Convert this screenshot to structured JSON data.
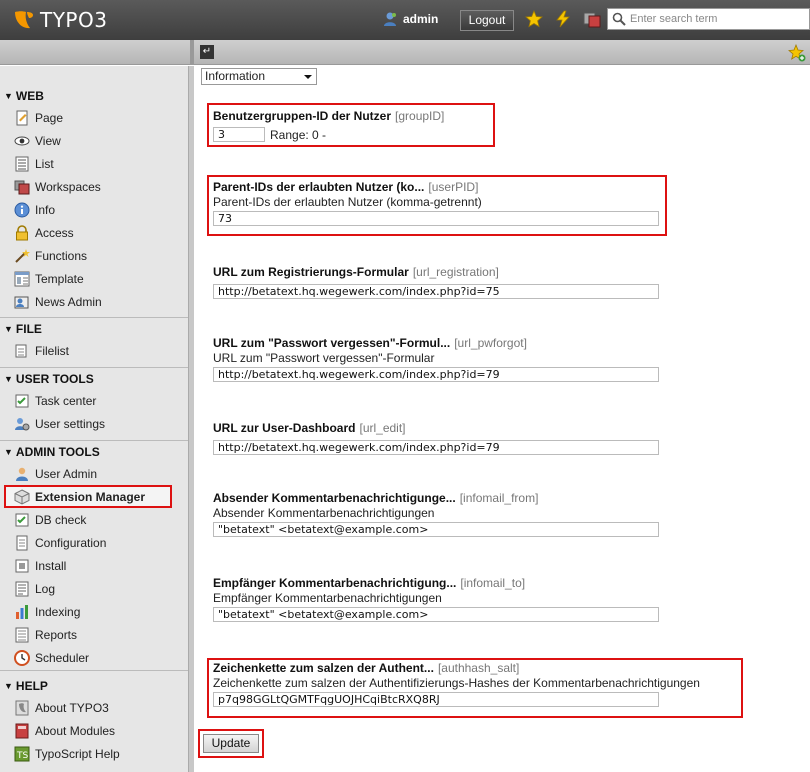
{
  "app": {
    "logo_text": "TYPO3"
  },
  "topbar": {
    "username": "admin",
    "logout_label": "Logout",
    "search_placeholder": "Enter search term"
  },
  "sidebar": {
    "groups": [
      {
        "title": "WEB",
        "items": [
          {
            "label": "Page",
            "icon": "page-icon"
          },
          {
            "label": "View",
            "icon": "eye-icon"
          },
          {
            "label": "List",
            "icon": "list-icon"
          },
          {
            "label": "Workspaces",
            "icon": "workspaces-icon"
          },
          {
            "label": "Info",
            "icon": "info-icon"
          },
          {
            "label": "Access",
            "icon": "lock-icon"
          },
          {
            "label": "Functions",
            "icon": "wand-icon"
          },
          {
            "label": "Template",
            "icon": "template-icon"
          },
          {
            "label": "News Admin",
            "icon": "news-icon"
          }
        ]
      },
      {
        "title": "FILE",
        "items": [
          {
            "label": "Filelist",
            "icon": "folder-icon"
          }
        ]
      },
      {
        "title": "USER TOOLS",
        "items": [
          {
            "label": "Task center",
            "icon": "task-icon"
          },
          {
            "label": "User settings",
            "icon": "user-settings-icon"
          }
        ]
      },
      {
        "title": "ADMIN TOOLS",
        "items": [
          {
            "label": "User Admin",
            "icon": "user-admin-icon"
          },
          {
            "label": "Extension Manager",
            "icon": "extension-icon"
          },
          {
            "label": "DB check",
            "icon": "db-check-icon"
          },
          {
            "label": "Configuration",
            "icon": "configuration-icon"
          },
          {
            "label": "Install",
            "icon": "install-icon"
          },
          {
            "label": "Log",
            "icon": "log-icon"
          },
          {
            "label": "Indexing",
            "icon": "indexing-icon"
          },
          {
            "label": "Reports",
            "icon": "reports-icon"
          },
          {
            "label": "Scheduler",
            "icon": "scheduler-icon"
          }
        ]
      },
      {
        "title": "HELP",
        "items": [
          {
            "label": "About TYPO3",
            "icon": "about-typo3-icon"
          },
          {
            "label": "About Modules",
            "icon": "about-modules-icon"
          },
          {
            "label": "TypoScript Help",
            "icon": "typoscript-icon"
          }
        ]
      }
    ]
  },
  "content": {
    "select_value": "Information",
    "fields": {
      "group_id": {
        "title": "Benutzergruppen-ID der Nutzer",
        "key": "[groupID]",
        "value": "3",
        "range": "Range: 0 -"
      },
      "user_pid": {
        "title": "Parent-IDs der erlaubten Nutzer (ko...",
        "key": "[userPID]",
        "desc": "Parent-IDs der erlaubten Nutzer (komma-getrennt)",
        "value": "73"
      },
      "url_registration": {
        "title": "URL zum Registrierungs-Formular",
        "key": "[url_registration]",
        "value": "http://betatext.hq.wegewerk.com/index.php?id=75"
      },
      "url_pwforgot": {
        "title": "URL zum \"Passwort vergessen\"-Formul...",
        "key": "[url_pwforgot]",
        "desc": "URL zum \"Passwort vergessen\"-Formular",
        "value": "http://betatext.hq.wegewerk.com/index.php?id=79"
      },
      "url_edit": {
        "title": "URL zur User-Dashboard",
        "key": "[url_edit]",
        "value": "http://betatext.hq.wegewerk.com/index.php?id=79"
      },
      "infomail_from": {
        "title": "Absender Kommentarbenachrichtigunge...",
        "key": "[infomail_from]",
        "desc": "Absender Kommentarbenachrichtigungen",
        "value": "\"betatext\" <betatext@example.com>"
      },
      "infomail_to": {
        "title": "Empfänger Kommentarbenachrichtigung...",
        "key": "[infomail_to]",
        "desc": "Empfänger Kommentarbenachrichtigungen",
        "value": "\"betatext\" <betatext@example.com>"
      },
      "authhash_salt": {
        "title": "Zeichenkette zum salzen der Authent...",
        "key": "[authhash_salt]",
        "desc": "Zeichenkette zum salzen der Authentifizierungs-Hashes der Kommentarbenachrichtigungen",
        "value": "p7q98GGLtQGMTFqgUOJHCqiBtcRXQ8RJ"
      }
    },
    "update_label": "Update"
  },
  "colors": {
    "highlight": "#dd1111",
    "typo3_orange": "#f49700"
  }
}
